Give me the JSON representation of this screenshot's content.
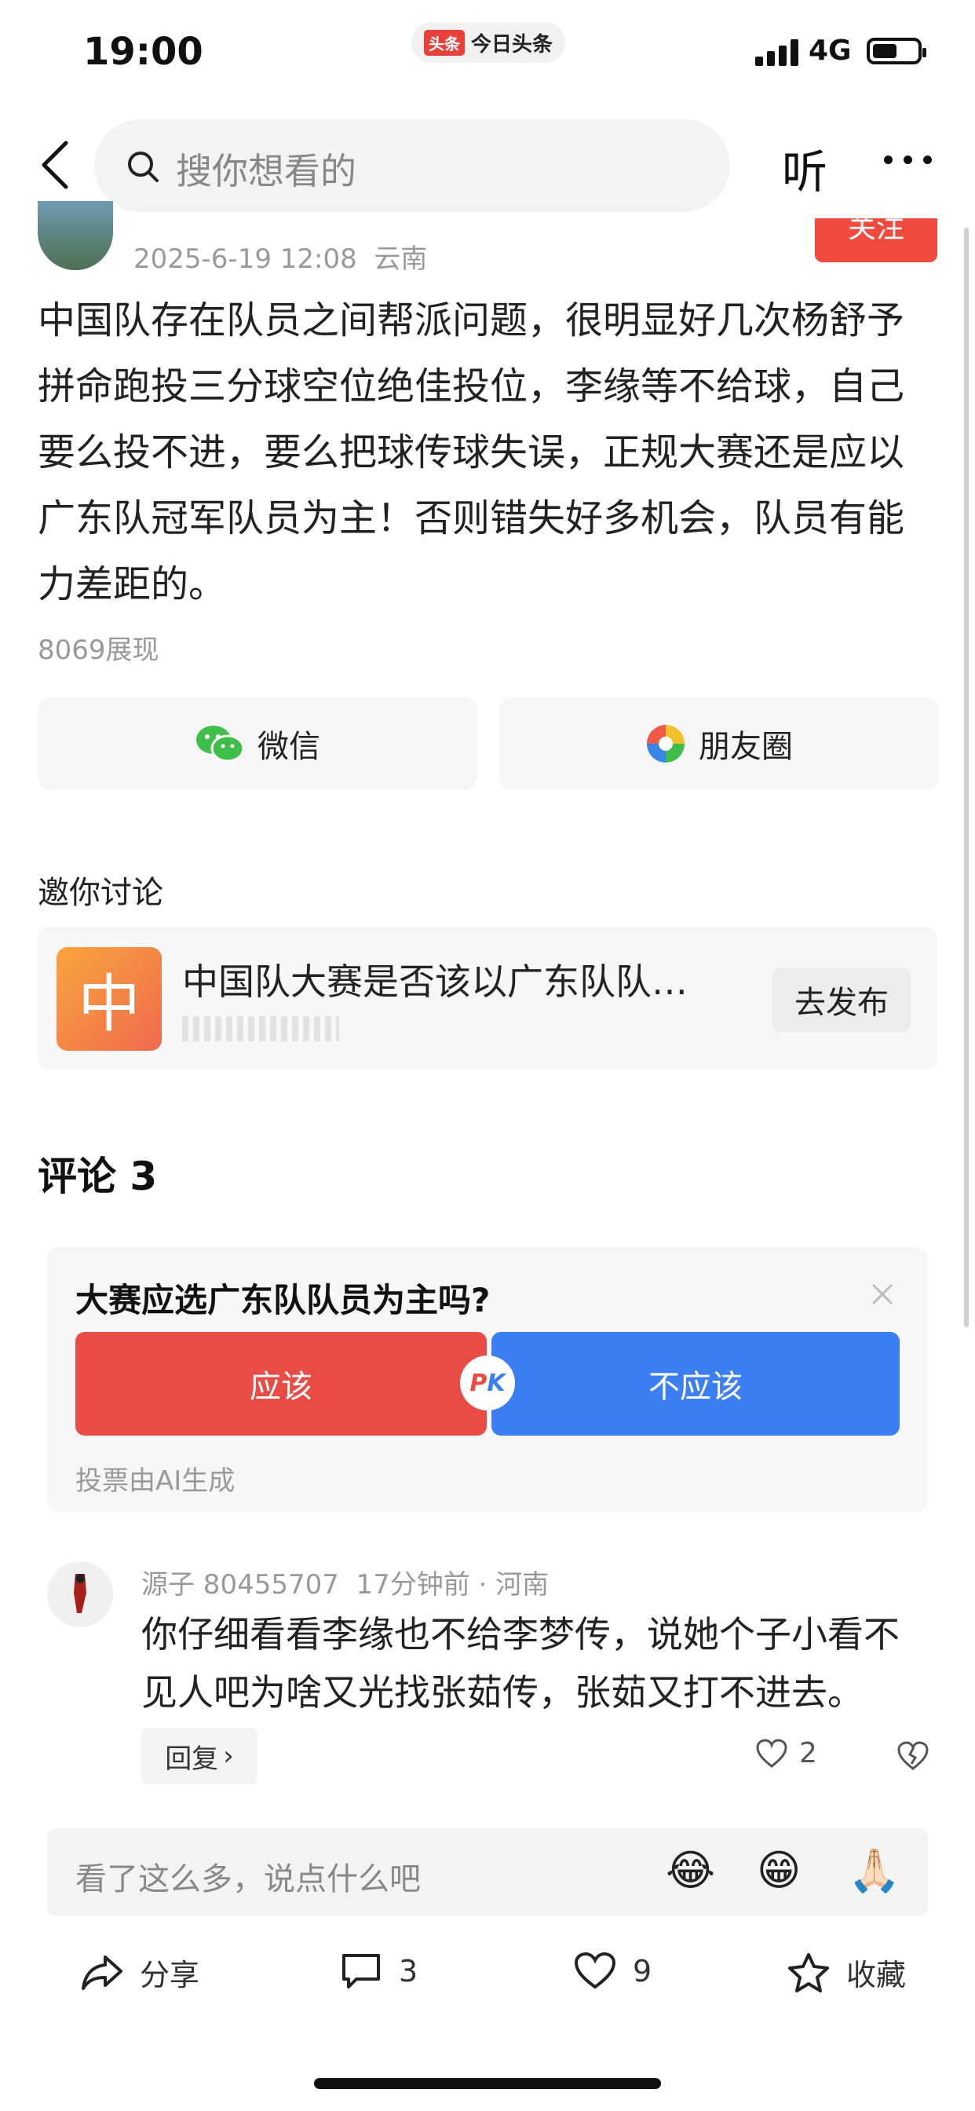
{
  "status_bar": {
    "time": "19:00",
    "app_tag": "头条",
    "app_name": "今日头条",
    "network": "4G"
  },
  "nav": {
    "search_placeholder": "搜你想看的",
    "listen_label": "听"
  },
  "post": {
    "meta": "2025-6-19 12:08  云南",
    "follow_label": "关注",
    "body": "中国队存在队员之间帮派问题，很明显好几次杨舒予拼命跑投三分球空位绝佳投位，李缘等不给球，自己要么投不进，要么把球传球失误，正规大赛还是应以广东队冠军队员为主！否则错失好多机会，队员有能力差距的。",
    "views": "8069展现"
  },
  "share": {
    "wechat_label": "微信",
    "moments_label": "朋友圈"
  },
  "invite": {
    "section_title": "邀你讨论",
    "thumb_char": "中",
    "topic_title": "中国队大赛是否该以广东队队…",
    "publish_label": "去发布"
  },
  "comments": {
    "title": "评论 3",
    "poll": {
      "question": "大赛应选广东队队员为主吗?",
      "yes_label": "应该",
      "no_label": "不应该",
      "pk_p": "P",
      "pk_k": "K",
      "note": "投票由AI生成"
    },
    "items": [
      {
        "meta": "源子 80455707  17分钟前 · 河南",
        "text": "你仔细看看李缘也不给李梦传，说她个子小看不见人吧为啥又光找张茹传，张茹又打不进去。",
        "reply_label": "回复",
        "like_count": "2"
      }
    ]
  },
  "input": {
    "placeholder": "看了这么多，说点什么吧",
    "emojis": [
      "😂",
      "😁",
      "🙏🏻"
    ]
  },
  "bottom_bar": {
    "share_label": "分享",
    "comment_count": "3",
    "like_count": "9",
    "favorite_label": "收藏"
  },
  "colors": {
    "accent_red": "#f04a3e",
    "poll_blue": "#3b7ff2",
    "poll_red": "#e84c45"
  }
}
